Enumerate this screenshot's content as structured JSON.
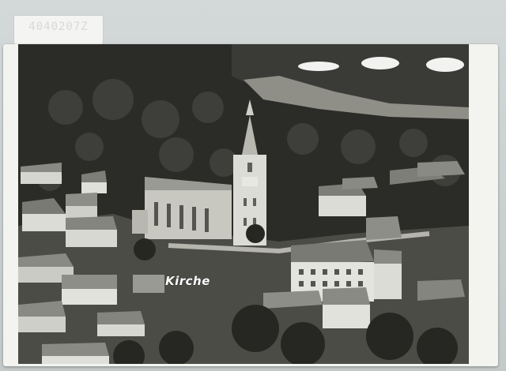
{
  "sticker": {
    "code": "4040207Z"
  },
  "photo": {
    "caption": "Kirche",
    "palette": {
      "forest": "#2c2c29",
      "forest_light": "#4a4a45",
      "roof": "#8e8e88",
      "wall": "#d6d6d0",
      "field": "#9a9a92",
      "sky_edge": "#6f6f69"
    }
  }
}
